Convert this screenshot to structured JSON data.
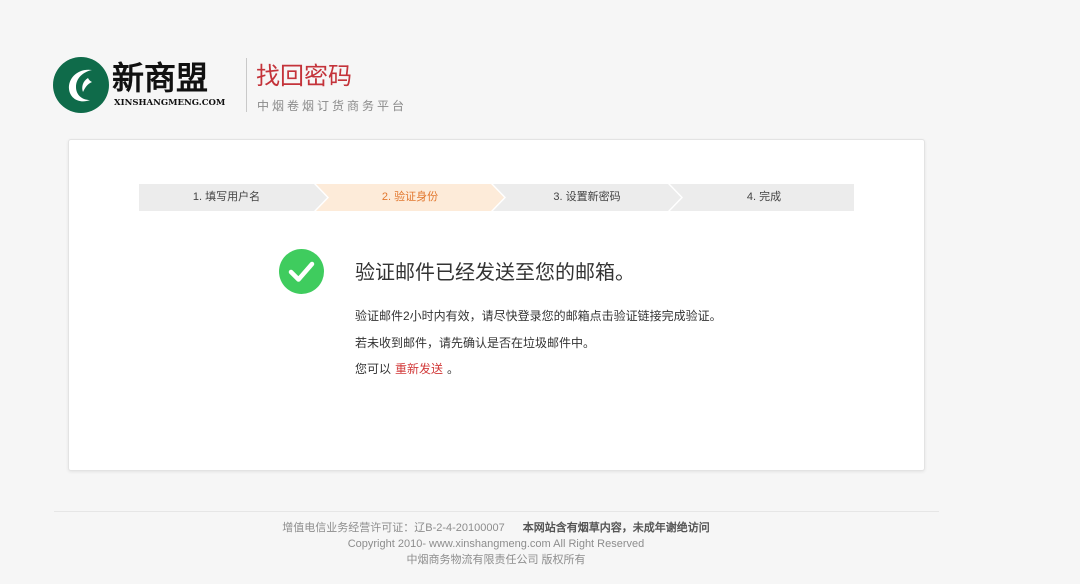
{
  "brand": {
    "name": "新商盟",
    "domain": "XINSHANGMENG.COM",
    "logo_color": "#0f6b4a"
  },
  "header": {
    "title": "找回密码",
    "subtitle": "中烟卷烟订货商务平台"
  },
  "steps": [
    {
      "label": "1. 填写用户名",
      "active": false
    },
    {
      "label": "2. 验证身份",
      "active": true
    },
    {
      "label": "3. 设置新密码",
      "active": false
    },
    {
      "label": "4. 完成",
      "active": false
    }
  ],
  "message": {
    "title": "验证邮件已经发送至您的邮箱。",
    "line1": "验证邮件2小时内有效，请尽快登录您的邮箱点击验证链接完成验证。",
    "line2": "若未收到邮件，请先确认是否在垃圾邮件中。",
    "line3_prefix": "您可以",
    "resend_label": "重新发送",
    "line3_suffix": "。"
  },
  "footer": {
    "license": "增值电信业务经营许可证：辽B-2-4-20100007",
    "warning": "本网站含有烟草内容，未成年谢绝访问",
    "copyright": "Copyright 2010- www.xinshangmeng.com All Right Reserved",
    "company": "中烟商务物流有限责任公司 版权所有"
  },
  "colors": {
    "accent": "#c4333a",
    "step_active_bg": "#fdebd9",
    "step_active_text": "#e2782f",
    "step_inactive_bg": "#ececec",
    "success": "#3fcc5e",
    "link": "#d23b3b"
  }
}
